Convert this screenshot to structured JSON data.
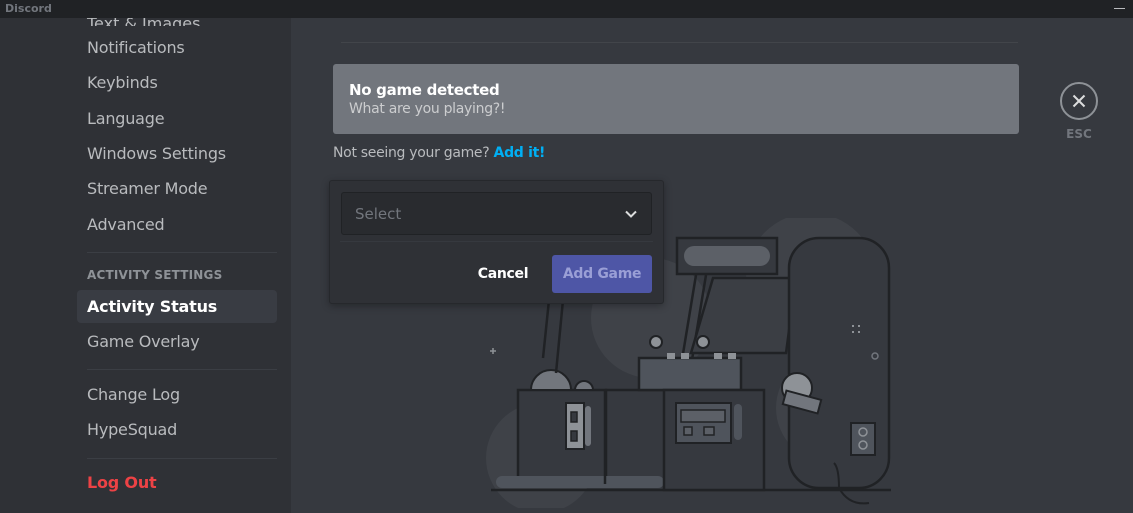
{
  "window": {
    "title": "Discord"
  },
  "sidebar": {
    "partial_item": "Text & Images",
    "items": [
      {
        "label": "Notifications"
      },
      {
        "label": "Keybinds"
      },
      {
        "label": "Language"
      },
      {
        "label": "Windows Settings"
      },
      {
        "label": "Streamer Mode"
      },
      {
        "label": "Advanced"
      }
    ],
    "activity_header": "ACTIVITY SETTINGS",
    "activity_items": [
      {
        "label": "Activity Status",
        "selected": true
      },
      {
        "label": "Game Overlay"
      }
    ],
    "misc_items": [
      {
        "label": "Change Log"
      },
      {
        "label": "HypeSquad"
      }
    ],
    "logout": "Log Out"
  },
  "main": {
    "no_game": {
      "title": "No game detected",
      "subtitle": "What are you playing?!"
    },
    "hint": {
      "text": "Not seeing your game?",
      "link": "Add it!"
    },
    "add_game_popup": {
      "select_placeholder": "Select",
      "cancel_label": "Cancel",
      "add_label": "Add Game"
    },
    "close": {
      "label": "ESC"
    }
  },
  "colors": {
    "accent": "#5865f2",
    "link": "#00aff4",
    "danger": "#ed4245"
  }
}
